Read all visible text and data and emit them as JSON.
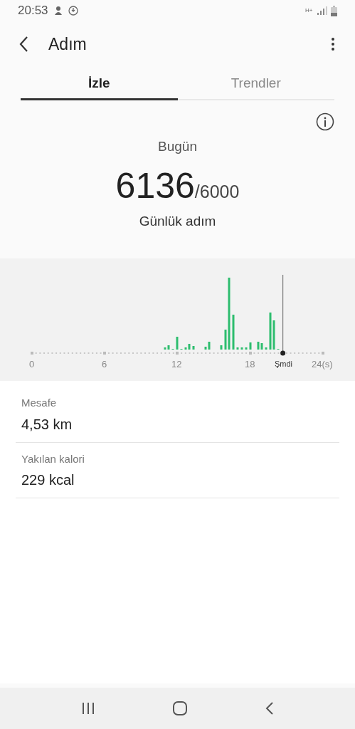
{
  "status_bar": {
    "time": "20:53",
    "network": "H+"
  },
  "header": {
    "title": "Adım"
  },
  "tabs": [
    {
      "label": "İzle",
      "selected": true
    },
    {
      "label": "Trendler",
      "selected": false
    }
  ],
  "summary": {
    "period": "Bugün",
    "steps": "6136",
    "goal": "/6000",
    "caption": "Günlük adım"
  },
  "activity_graph": {
    "axis_labels": [
      "0",
      "6",
      "12",
      "18",
      "24(s)"
    ],
    "now_label": "Şmdi"
  },
  "stats": [
    {
      "label": "Mesafe",
      "value": "4,53 km"
    },
    {
      "label": "Yakılan kalori",
      "value": "229 kcal"
    }
  ]
}
